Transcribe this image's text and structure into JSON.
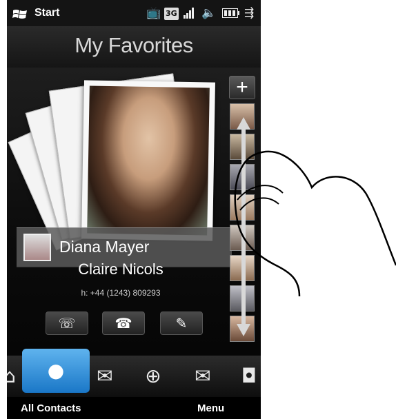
{
  "status_bar": {
    "start_label": "Start",
    "icons": [
      "windows-logo-icon",
      "tv-icon",
      "3g-icon",
      "signal-icon",
      "speaker-icon",
      "battery-icon",
      "sync-icon"
    ]
  },
  "screen": {
    "title": "My Favorites"
  },
  "featured_contact": {
    "name": "Claire Nicols",
    "phone": "h: +44 (1243) 809293"
  },
  "overlay_contact": {
    "name": "Diana Mayer"
  },
  "actions": [
    {
      "name": "call-contact-button",
      "icon": "phone-list-icon",
      "glyph": "☏"
    },
    {
      "name": "call-home-button",
      "icon": "call-home-icon",
      "glyph": "☎"
    },
    {
      "name": "send-message-button",
      "icon": "compose-icon",
      "glyph": "✎"
    }
  ],
  "thumb_strip": {
    "add_label": "+",
    "thumbs": 8
  },
  "tabs": [
    {
      "name": "tab-home",
      "icon": "home-icon",
      "glyph": "⌂"
    },
    {
      "name": "tab-people",
      "icon": "person-icon",
      "glyph": "●"
    },
    {
      "name": "tab-messages",
      "icon": "message-icon",
      "glyph": "✉"
    },
    {
      "name": "tab-internet",
      "icon": "globe-icon",
      "glyph": "⊕"
    },
    {
      "name": "tab-email",
      "icon": "envelope-icon",
      "glyph": "✉"
    },
    {
      "name": "tab-camera",
      "icon": "camera-icon",
      "glyph": "◘"
    }
  ],
  "softkeys": {
    "left": "All Contacts",
    "right": "Menu"
  },
  "colors": {
    "tab_active": "#3a98df",
    "background": "#0b0b0b"
  }
}
